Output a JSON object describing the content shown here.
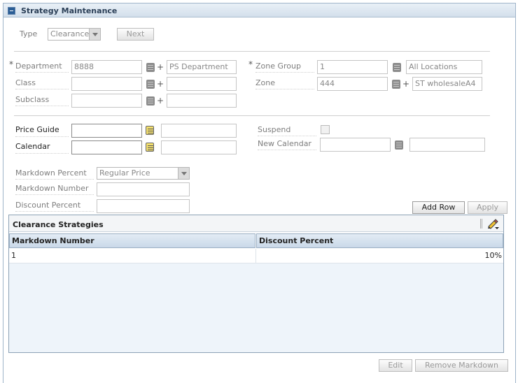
{
  "panel": {
    "title": "Strategy Maintenance"
  },
  "type_section": {
    "type_label": "Type",
    "type_value": "Clearance",
    "next_label": "Next"
  },
  "location": {
    "required_mark": "*",
    "department_label": "Department",
    "department_value": "8888",
    "department_desc": "PS Department",
    "class_label": "Class",
    "class_value": "",
    "class_desc": "",
    "subclass_label": "Subclass",
    "subclass_value": "",
    "subclass_desc": "",
    "zone_group_label": "Zone Group",
    "zone_group_value": "1",
    "zone_group_desc": "All Locations",
    "zone_label": "Zone",
    "zone_value": "444",
    "zone_desc": "ST wholesaleA4",
    "plus": "+"
  },
  "guide": {
    "price_guide_label": "Price Guide",
    "price_guide_value": "",
    "price_guide_desc": "",
    "calendar_label": "Calendar",
    "calendar_value": "",
    "calendar_desc": "",
    "suspend_label": "Suspend",
    "new_calendar_label": "New Calendar",
    "new_calendar_value": "",
    "new_calendar_desc": ""
  },
  "markdown": {
    "percent_label": "Markdown Percent",
    "percent_value": "Regular Price",
    "number_label": "Markdown Number",
    "number_value": "",
    "discount_label": "Discount Percent",
    "discount_value": "",
    "add_row_label": "Add Row",
    "apply_label": "Apply"
  },
  "grid": {
    "title": "Clearance Strategies",
    "columns": [
      "Markdown Number",
      "Discount Percent"
    ],
    "rows": [
      {
        "markdown_number": "1",
        "discount_percent": "10%"
      }
    ]
  },
  "footer": {
    "edit_label": "Edit",
    "remove_label": "Remove Markdown"
  }
}
